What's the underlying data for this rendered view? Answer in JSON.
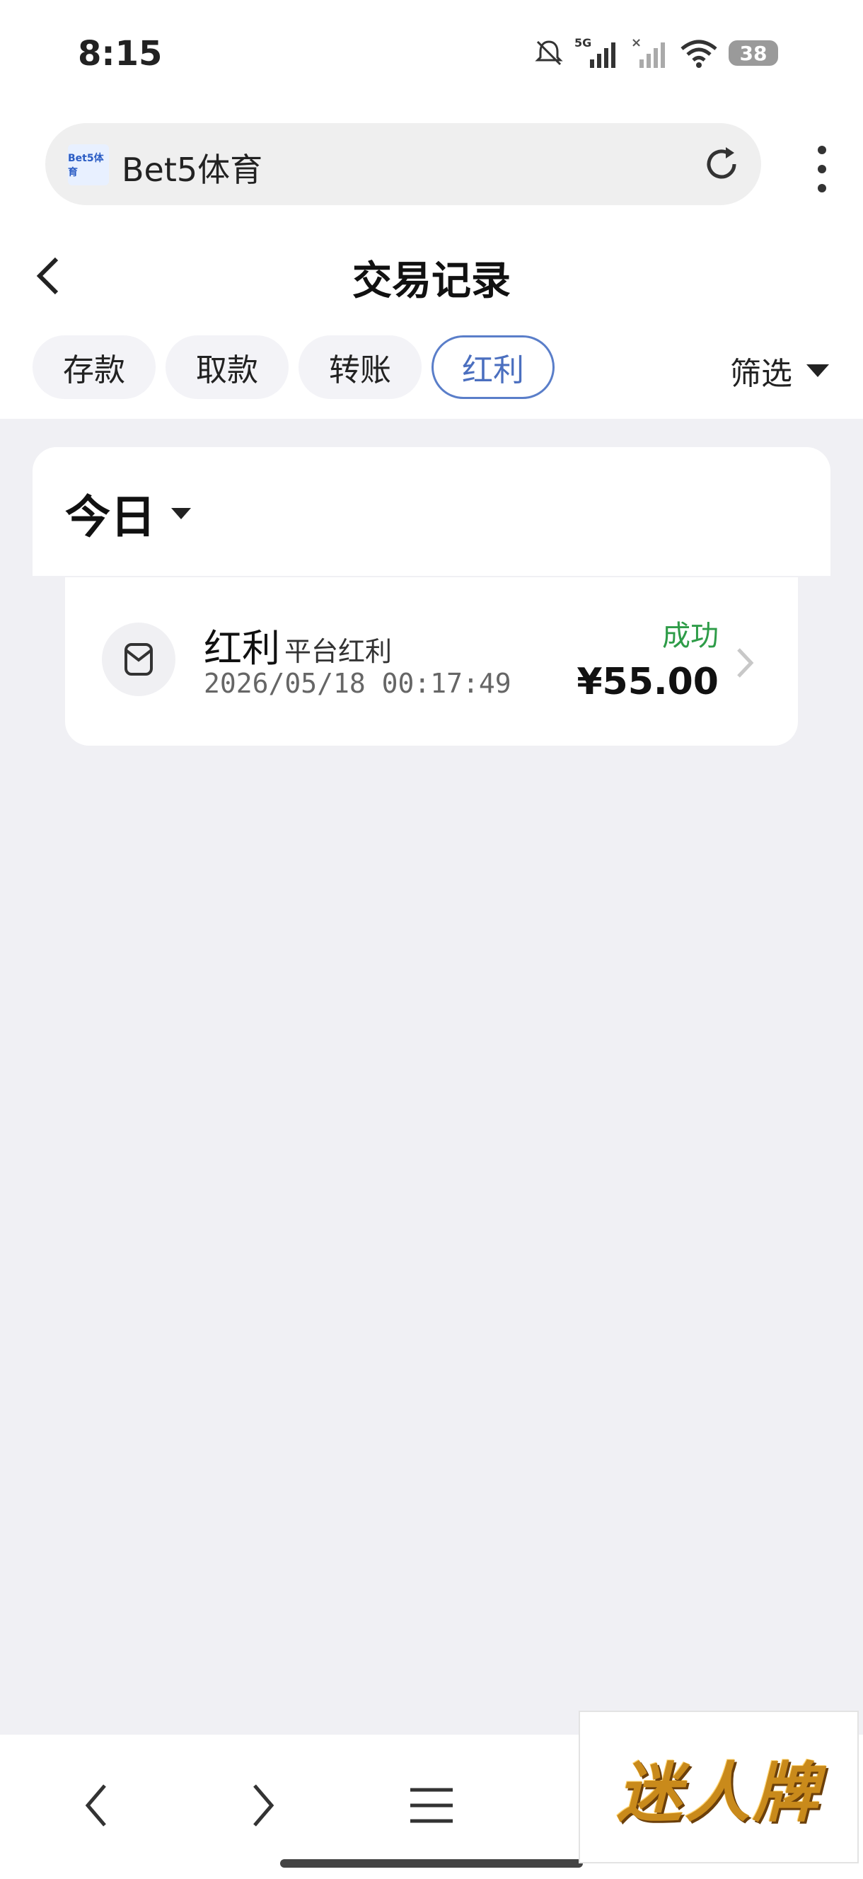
{
  "status_bar": {
    "time": "8:15",
    "battery": "38",
    "network": "5G"
  },
  "browser": {
    "favicon_text": "Bet5体育",
    "url_text": "Bet5体育"
  },
  "header": {
    "title": "交易记录"
  },
  "tabs": [
    {
      "label": "存款",
      "active": false
    },
    {
      "label": "取款",
      "active": false
    },
    {
      "label": "转账",
      "active": false
    },
    {
      "label": "红利",
      "active": true
    }
  ],
  "filter": {
    "label": "筛选"
  },
  "date_group": {
    "label": "今日"
  },
  "records": [
    {
      "type": "红利",
      "subtype": "平台红利",
      "timestamp": "2026/05/18 00:17:49",
      "status": "成功",
      "amount": "¥55.00"
    }
  ],
  "watermark": {
    "text": "迷人牌"
  },
  "colors": {
    "accent": "#4b6fbf",
    "success": "#2e9c48",
    "background": "#f0f0f4"
  }
}
